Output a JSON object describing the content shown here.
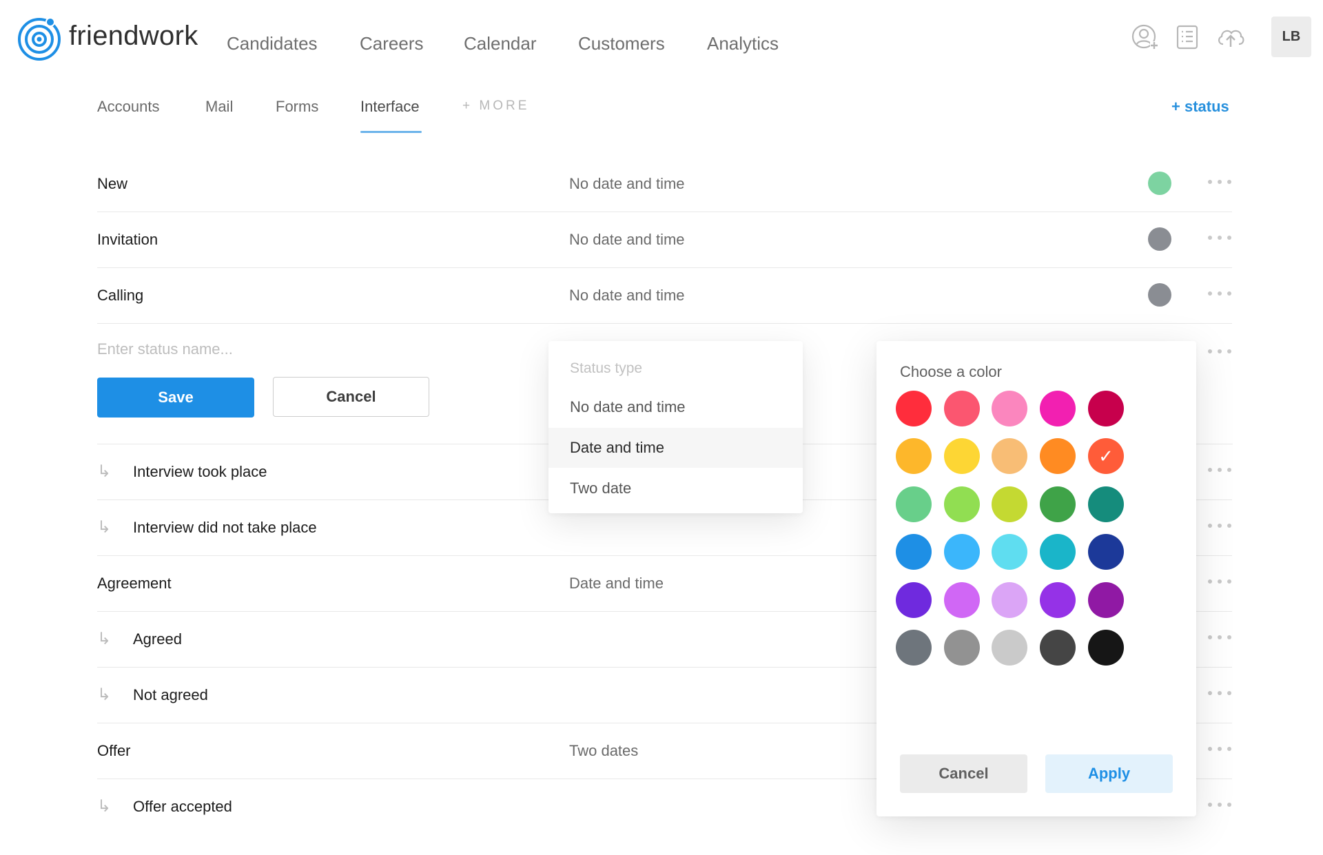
{
  "brand": {
    "name": "friendwork",
    "logo_icon": "friendwork-logo-icon"
  },
  "top_nav": [
    "Candidates",
    "Careers",
    "Calendar",
    "Customers",
    "Analytics"
  ],
  "top_icons": [
    "add-user-icon",
    "list-document-icon",
    "cloud-upload-icon"
  ],
  "avatar_initials": "LB",
  "sub_nav": {
    "tabs": [
      "Accounts",
      "Mail",
      "Forms",
      "Interface"
    ],
    "active": "Interface",
    "more_label": "+ MORE",
    "add_status_label": "+ status"
  },
  "statuses_top": [
    {
      "name": "New",
      "type": "No date and time",
      "color": "#7dd3a1"
    },
    {
      "name": "Invitation",
      "type": "No date and time",
      "color": "#8a8d93"
    },
    {
      "name": "Calling",
      "type": "No date and time",
      "color": "#8a8d93"
    }
  ],
  "edit_row": {
    "placeholder": "Enter status name...",
    "save_label": "Save",
    "cancel_label": "Cancel"
  },
  "statuses_bottom": [
    {
      "name": "Interview took place",
      "type": "",
      "sub": true,
      "arrow": "↳"
    },
    {
      "name": "Interview did not take place",
      "type": "",
      "sub": true,
      "arrow": "↳"
    },
    {
      "name": "Agreement",
      "type": "Date and time",
      "sub": false,
      "arrow": ""
    },
    {
      "name": "Agreed",
      "type": "",
      "sub": true,
      "arrow": "↳"
    },
    {
      "name": "Not agreed",
      "type": "",
      "sub": true,
      "arrow": "↳"
    },
    {
      "name": "Offer",
      "type": "Two dates",
      "sub": false,
      "arrow": ""
    },
    {
      "name": "Offer accepted",
      "type": "",
      "sub": true,
      "arrow": "↳"
    }
  ],
  "status_type_dropdown": {
    "header": "Status type",
    "options": [
      "No date and time",
      "Date and time",
      "Two date"
    ],
    "selected_index": 1
  },
  "color_picker": {
    "title": "Choose a color",
    "selected": "#ff5c39",
    "check_glyph": "✓",
    "rows": [
      [
        "#ff2d3c",
        "#fb5670",
        "#fb86be",
        "#f220b1",
        "#c7004c"
      ],
      [
        "#fdb72b",
        "#fdd634",
        "#f8bd75",
        "#ff8b22",
        "#ff5c39"
      ],
      [
        "#68cf8a",
        "#91de52",
        "#c4d932",
        "#3fa348",
        "#158c7c"
      ],
      [
        "#1e8fe5",
        "#3bb6fb",
        "#5fddf0",
        "#1ab5c9",
        "#1c3999"
      ],
      [
        "#6f2ade",
        "#d067f5",
        "#dba5f6",
        "#9532e7",
        "#9019a4"
      ],
      [
        "#6e757c",
        "#929292",
        "#cacaca",
        "#454545",
        "#161616"
      ]
    ],
    "cancel_label": "Cancel",
    "apply_label": "Apply"
  }
}
